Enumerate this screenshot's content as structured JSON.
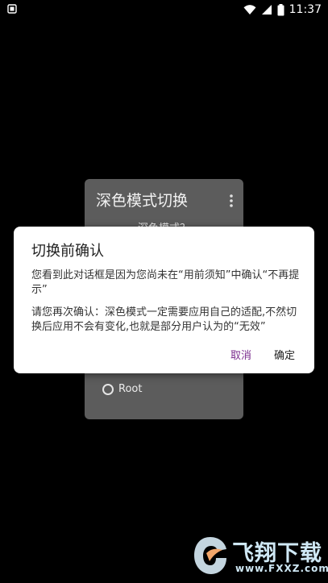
{
  "status_bar": {
    "time": "11:37",
    "icons": [
      "notification-icon",
      "wifi-icon",
      "signal-icon",
      "battery-icon"
    ]
  },
  "background_card": {
    "title": "深色模式切换",
    "subtitle": "深色模式？",
    "option_root": "Root"
  },
  "dialog": {
    "title": "切换前确认",
    "message_1": "您看到此对话框是因为您尚未在“用前须知”中确认“不再提示”",
    "message_2": "请您再次确认：深色模式一定需要应用自己的适配,不然切换后应用不会有变化,也就是部分用户认为的“无效”",
    "cancel_label": "取消",
    "confirm_label": "确定",
    "cancel_color": "#7b2d8e"
  },
  "watermark": {
    "brand": "飞翔下载",
    "url": "www.FXXZ.com"
  }
}
